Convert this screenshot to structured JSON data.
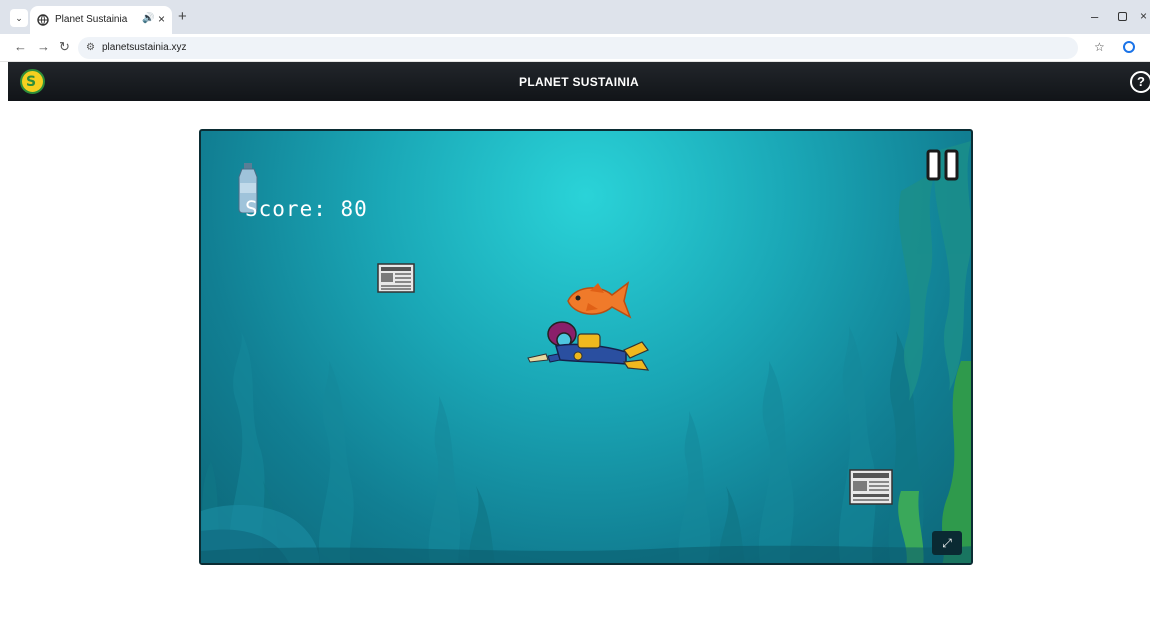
{
  "browser": {
    "tab_title": "Planet Sustainia",
    "url": "planetsustainia.xyz",
    "icons": [
      "dropdown-icon",
      "globe-icon",
      "audio-icon",
      "close-icon",
      "plus-icon",
      "back-icon",
      "forward-icon",
      "reload-icon",
      "site-settings-icon",
      "star-icon",
      "profile-icon",
      "minimize-icon",
      "maximize-icon"
    ]
  },
  "app": {
    "title": "PLANET SUSTAINIA",
    "help_label": "?",
    "logo_icon": "sustainia-logo"
  },
  "game": {
    "score_text": "Score: 80",
    "items": [
      "plastic-bottle",
      "newspaper",
      "newspaper",
      "fish",
      "diver"
    ],
    "controls": [
      "pause-icon",
      "fullscreen-icon"
    ],
    "colors": {
      "water_top": "#2ad3d8",
      "water_bottom": "#0d6577",
      "fish": "#f07a2a"
    }
  }
}
